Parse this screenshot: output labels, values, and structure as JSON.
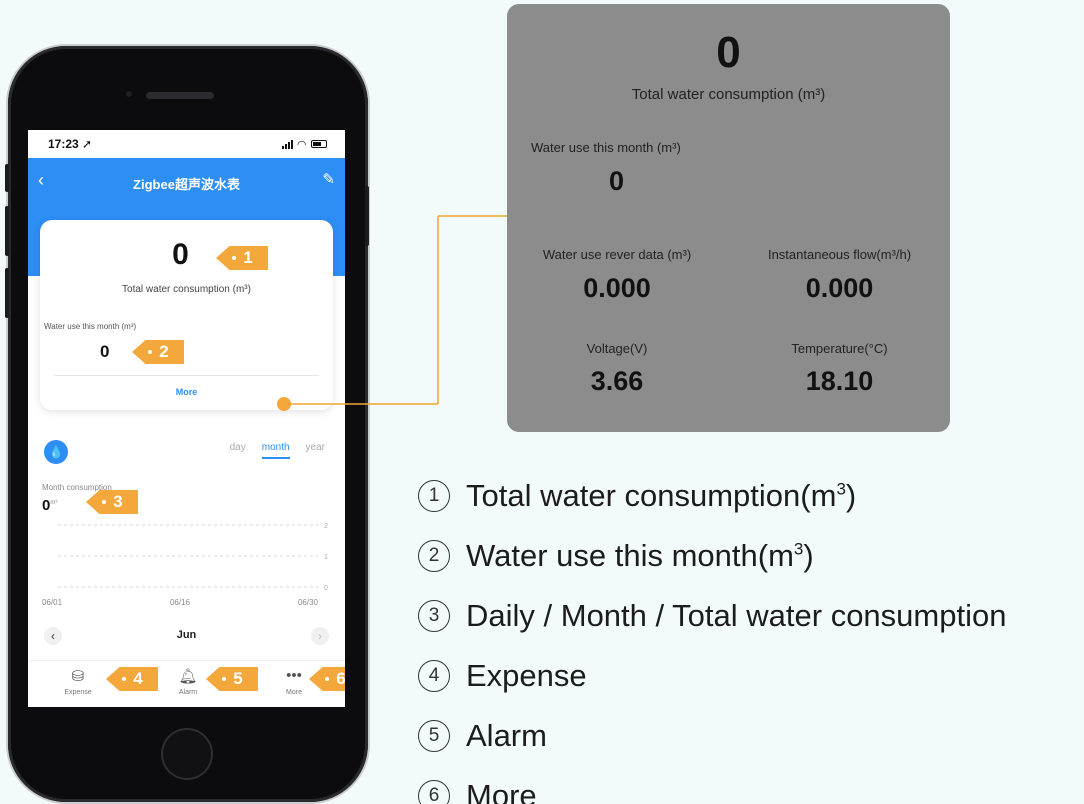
{
  "phone": {
    "status": {
      "time": "17:23 ➚"
    },
    "header": {
      "back_icon": "‹",
      "title": "Zigbee超声波水表",
      "edit_icon": "✎"
    },
    "summary": {
      "total_value": "0",
      "total_label": "Total water consumption (m³)",
      "month_label": "Water use this month (m³)",
      "month_value": "0",
      "more_link": "More"
    },
    "chart": {
      "tabs": [
        "day",
        "month",
        "year"
      ],
      "active_tab": "month",
      "label": "Month consumption",
      "value": "0",
      "unit": "m³"
    },
    "month_nav": {
      "prev": "‹",
      "label": "Jun",
      "next": "›"
    },
    "tabbar": [
      {
        "label": "Expense",
        "icon": "coins-icon"
      },
      {
        "label": "Alarm",
        "icon": "bell-icon"
      },
      {
        "label": "More",
        "icon": "more-dots-icon"
      }
    ]
  },
  "chart_data": {
    "type": "line",
    "x_ticks": [
      "06/01",
      "06/16",
      "06/30"
    ],
    "y_ticks": [
      "2",
      "1",
      "0"
    ],
    "series": [
      {
        "values": []
      }
    ],
    "ylim": [
      0,
      2
    ]
  },
  "tags": [
    "1",
    "2",
    "3",
    "4",
    "5",
    "6"
  ],
  "detail": {
    "total_value": "0",
    "total_label": "Total water consumption (m³)",
    "month_label": "Water use this month (m³)",
    "month_value": "0",
    "reverse_label": "Water use rever data (m³)",
    "reverse_value": "0.000",
    "flow_label": "Instantaneous flow(m³/h)",
    "flow_value": "0.000",
    "voltage_label": "Voltage(V)",
    "voltage_value": "3.66",
    "temp_label": "Temperature(°C)",
    "temp_value": "18.10"
  },
  "legend": [
    {
      "num": "1",
      "text": "Total water consumption(m",
      "sup": "3",
      "tail": ")"
    },
    {
      "num": "2",
      "text": "Water use this month(m",
      "sup": "3",
      "tail": ")"
    },
    {
      "num": "3",
      "text": "Daily / Month / Total water consumption",
      "sup": "",
      "tail": ""
    },
    {
      "num": "4",
      "text": "Expense",
      "sup": "",
      "tail": ""
    },
    {
      "num": "5",
      "text": "Alarm",
      "sup": "",
      "tail": ""
    },
    {
      "num": "6",
      "text": "More",
      "sup": "",
      "tail": ""
    }
  ],
  "colors": {
    "accent": "#2d8ef5",
    "tag": "#f4a73a",
    "panel": "#8c8c8c"
  }
}
